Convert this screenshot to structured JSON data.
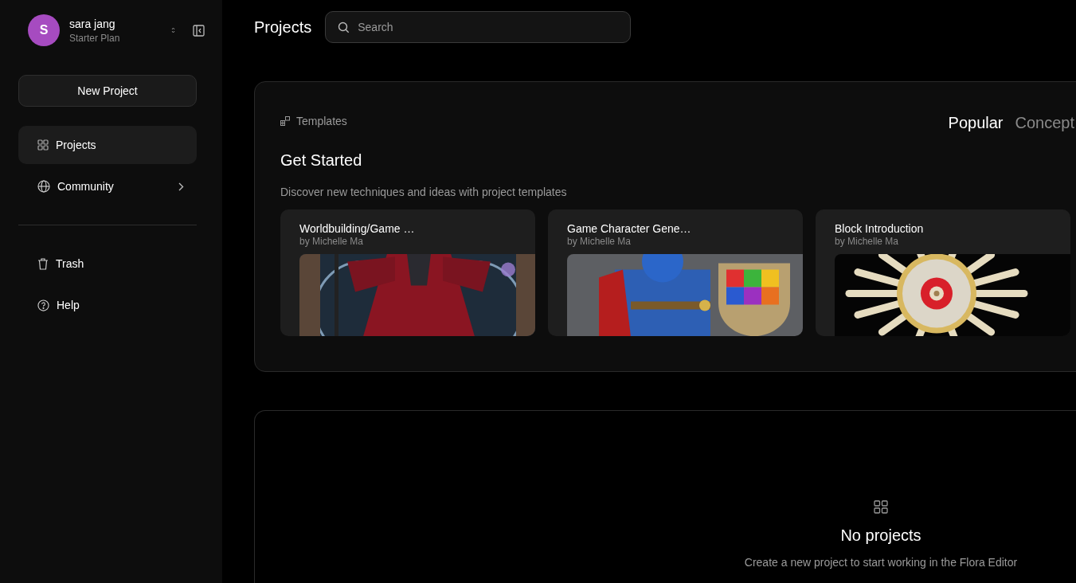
{
  "user": {
    "avatar_letter": "S",
    "name": "sara jang",
    "plan": "Starter Plan"
  },
  "new_project_button": "New Project",
  "nav": [
    {
      "label": "Projects",
      "selected": true,
      "has_arrow": false
    },
    {
      "label": "Community",
      "selected": false,
      "has_arrow": true
    }
  ],
  "nav_secondary": [
    {
      "label": "Trash",
      "selected": false
    },
    {
      "label": "Help",
      "selected": false
    }
  ],
  "page_title": "Projects",
  "search": {
    "placeholder": "Search"
  },
  "templates": {
    "label": "Templates",
    "heading": "Get Started",
    "description": "Discover new techniques and ideas with project templates",
    "tabs": [
      {
        "label": "Popular",
        "selected": true
      },
      {
        "label": "Concept",
        "selected": false
      }
    ],
    "cards": [
      {
        "title": "Worldbuilding/Game …",
        "author": "by Michelle Ma"
      },
      {
        "title": "Game Character Gene…",
        "author": "by Michelle Ma"
      },
      {
        "title": "Block Introduction",
        "author": "by Michelle Ma"
      }
    ]
  },
  "empty_state": {
    "title": "No projects",
    "message": "Create a new project to start working in the Flora Editor"
  }
}
